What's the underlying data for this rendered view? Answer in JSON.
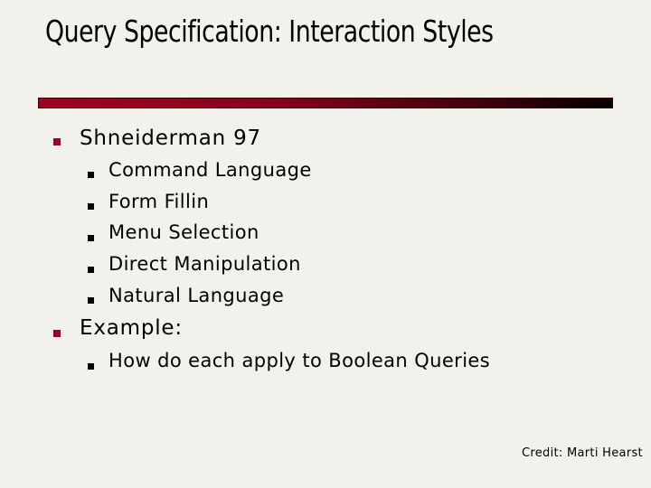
{
  "slide": {
    "title": "Query Specification: Interaction Styles",
    "accent_color": "#a10024",
    "bullets": [
      {
        "label": "Shneiderman 97",
        "sub": [
          "Command Language",
          "Form Fillin",
          "Menu Selection",
          "Direct Manipulation",
          "Natural Language"
        ]
      },
      {
        "label": "Example:",
        "sub": [
          "How do each apply to Boolean Queries"
        ]
      }
    ],
    "credit": "Credit: Marti Hearst"
  }
}
